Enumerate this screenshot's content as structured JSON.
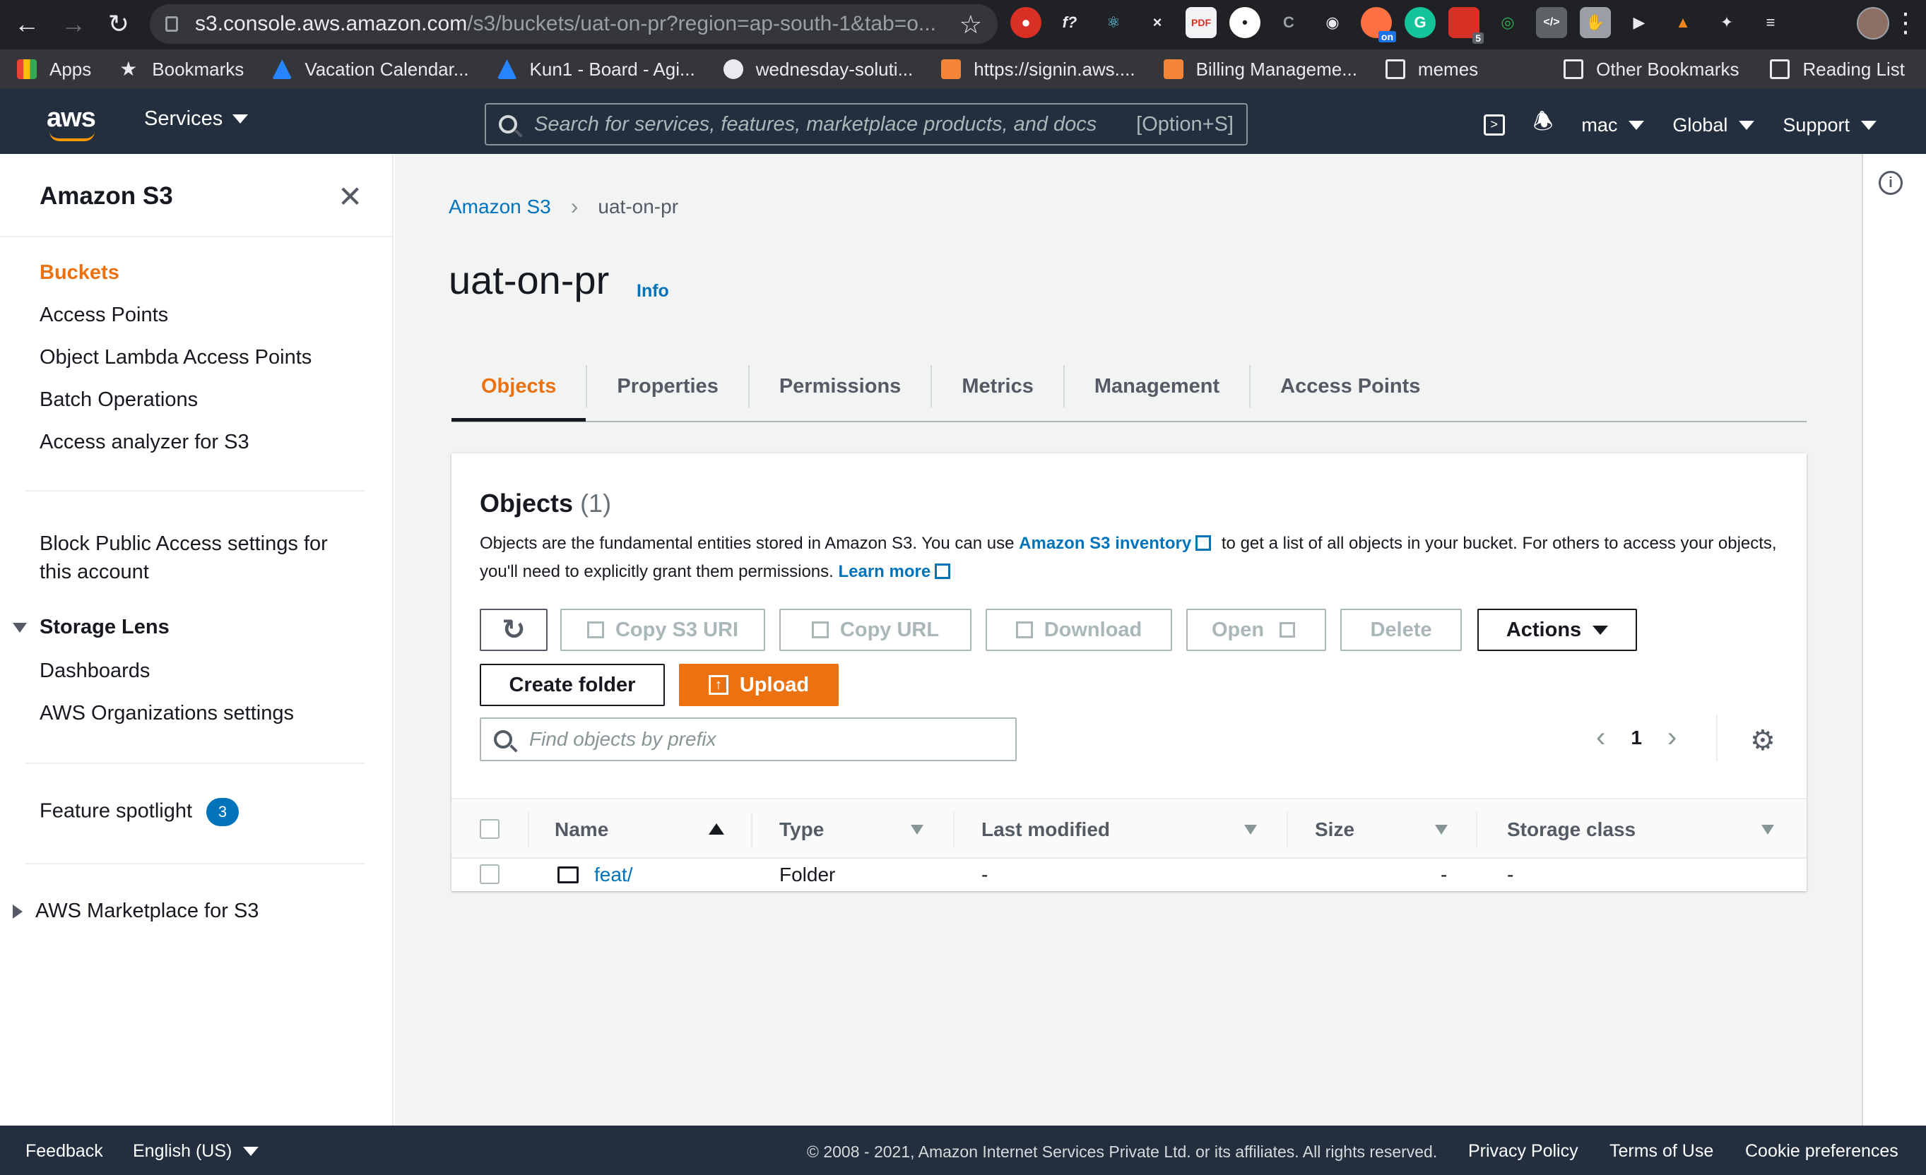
{
  "browser": {
    "url_host": "s3.console.aws.amazon.com",
    "url_path": "/s3/buckets/uat-on-pr?region=ap-south-1&tab=o...",
    "bookmarks": [
      "Apps",
      "Bookmarks",
      "Vacation Calendar...",
      "Kun1 - Board - Agi...",
      "wednesday-soluti...",
      "https://signin.aws....",
      "Billing Manageme...",
      "memes"
    ],
    "bookmarks_right": [
      "Other Bookmarks",
      "Reading List"
    ],
    "extension_badge": "5",
    "extension_on_label": "on"
  },
  "aws_header": {
    "logo": "aws",
    "services": "Services",
    "search_placeholder": "Search for services, features, marketplace products, and docs",
    "search_shortcut": "[Option+S]",
    "user": "mac",
    "region": "Global",
    "support": "Support"
  },
  "sidebar": {
    "title": "Amazon S3",
    "items": [
      "Buckets",
      "Access Points",
      "Object Lambda Access Points",
      "Batch Operations",
      "Access analyzer for S3"
    ],
    "block_public_access_line1": "Block Public Access settings for",
    "block_public_access_line2": "this account",
    "storage_lens": "Storage Lens",
    "storage_lens_items": [
      "Dashboards",
      "AWS Organizations settings"
    ],
    "feature_spotlight": "Feature spotlight",
    "feature_spotlight_count": "3",
    "marketplace": "AWS Marketplace for S3"
  },
  "breadcrumb": {
    "root": "Amazon S3",
    "current": "uat-on-pr"
  },
  "page": {
    "title": "uat-on-pr",
    "info": "Info"
  },
  "tabs": [
    "Objects",
    "Properties",
    "Permissions",
    "Metrics",
    "Management",
    "Access Points"
  ],
  "objects_panel": {
    "title": "Objects",
    "count": "(1)",
    "desc_1": "Objects are the fundamental entities stored in Amazon S3. You can use ",
    "desc_link_1": "Amazon S3 inventory",
    "desc_2": " to get a list of all objects in your bucket. For others to access your objects, you'll need to explicitly grant them permissions. ",
    "desc_link_2": "Learn more",
    "buttons": {
      "copy_s3_uri": "Copy S3 URI",
      "copy_url": "Copy URL",
      "download": "Download",
      "open": "Open",
      "delete": "Delete",
      "actions": "Actions",
      "create_folder": "Create folder",
      "upload": "Upload"
    },
    "find_placeholder": "Find objects by prefix",
    "page_number": "1",
    "columns": [
      "Name",
      "Type",
      "Last modified",
      "Size",
      "Storage class"
    ],
    "rows": [
      {
        "name": "feat/",
        "type": "Folder",
        "last_modified": "-",
        "size": "-",
        "storage_class": "-"
      }
    ]
  },
  "footer": {
    "feedback": "Feedback",
    "language": "English (US)",
    "copyright": "© 2008 - 2021, Amazon Internet Services Private Ltd. or its affiliates. All rights reserved.",
    "privacy": "Privacy Policy",
    "terms": "Terms of Use",
    "cookies": "Cookie preferences"
  },
  "colors": {
    "accent": "#ec7211",
    "link": "#0073bb",
    "header_bg": "#232f3e"
  }
}
